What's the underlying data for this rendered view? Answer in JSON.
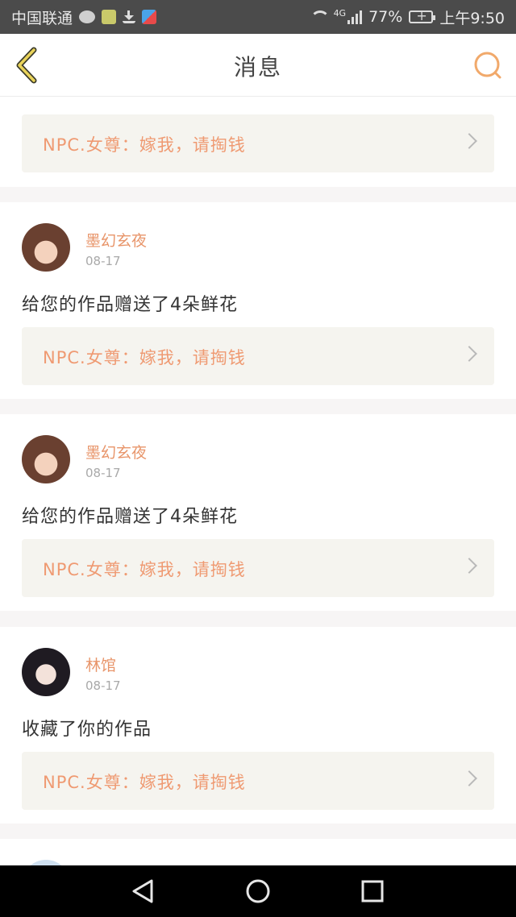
{
  "status_bar": {
    "carrier": "中国联通",
    "network": "4G",
    "battery": "77%",
    "time": "上午9:50"
  },
  "header": {
    "title": "消息",
    "accent_color": "#f1a96b"
  },
  "messages": [
    {
      "quote": "NPC.女尊：嫁我，请掏钱"
    },
    {
      "user": "墨幻玄夜",
      "date": "08-17",
      "text": "给您的作品赠送了4朵鲜花",
      "quote": "NPC.女尊：嫁我，请掏钱"
    },
    {
      "user": "墨幻玄夜",
      "date": "08-17",
      "text": "给您的作品赠送了4朵鲜花",
      "quote": "NPC.女尊：嫁我，请掏钱"
    },
    {
      "user": "林馆",
      "date": "08-17",
      "text": "收藏了你的作品",
      "quote": "NPC.女尊：嫁我，请掏钱"
    }
  ],
  "icons": {
    "back": "chevron-left-icon",
    "search": "search-icon",
    "nav_back": "triangle-back-icon",
    "nav_home": "circle-home-icon",
    "nav_recent": "square-recent-icon"
  }
}
